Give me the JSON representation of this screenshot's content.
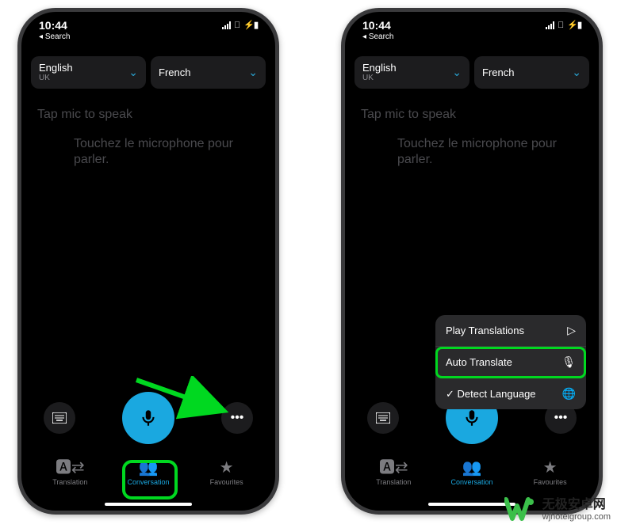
{
  "status": {
    "time": "10:44",
    "back_label": "Search"
  },
  "languages": {
    "left": {
      "name": "English",
      "sub": "UK"
    },
    "right": {
      "name": "French",
      "sub": ""
    }
  },
  "prompts": {
    "en": "Tap mic to speak",
    "fr": "Touchez le microphone pour parler."
  },
  "tabs": {
    "translation": "Translation",
    "conversation": "Conversation",
    "favourites": "Favourites"
  },
  "popup": {
    "play": "Play Translations",
    "auto": "Auto Translate",
    "detect": "Detect Language"
  },
  "watermark": {
    "cn": "无极安卓网",
    "url": "wjhotelgroup.com"
  }
}
